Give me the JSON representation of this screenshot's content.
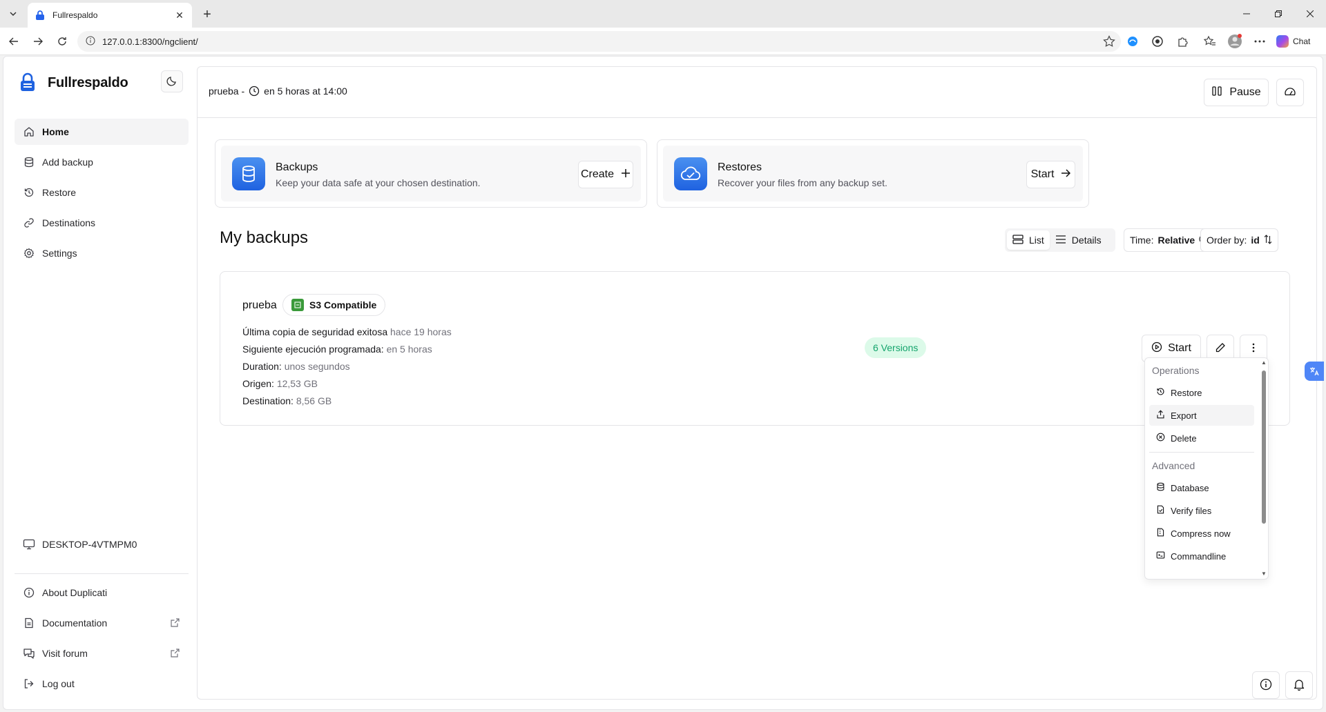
{
  "browser": {
    "tab_title": "Fullrespaldo",
    "url": "127.0.0.1:8300/ngclient/",
    "chat_label": "Chat"
  },
  "sidebar": {
    "brand": "Fullrespaldo",
    "items": [
      {
        "label": "Home",
        "icon": "home-icon",
        "active": true
      },
      {
        "label": "Add backup",
        "icon": "database-icon"
      },
      {
        "label": "Restore",
        "icon": "history-icon"
      },
      {
        "label": "Destinations",
        "icon": "link-icon"
      },
      {
        "label": "Settings",
        "icon": "gear-icon"
      }
    ],
    "machine": "DESKTOP-4VTMPM0",
    "bottom": [
      {
        "label": "About Duplicati",
        "icon": "info-icon"
      },
      {
        "label": "Documentation",
        "icon": "document-icon",
        "external": true
      },
      {
        "label": "Visit forum",
        "icon": "chat-icon",
        "external": true
      },
      {
        "label": "Log out",
        "icon": "logout-icon"
      }
    ]
  },
  "topbar": {
    "status_name": "prueba -",
    "status_next": "en 5 horas at 14:00",
    "pause_label": "Pause"
  },
  "cards": {
    "backups": {
      "title": "Backups",
      "subtitle": "Keep your data safe at your chosen destination.",
      "button": "Create"
    },
    "restores": {
      "title": "Restores",
      "subtitle": "Recover your files from any backup set.",
      "button": "Start"
    }
  },
  "my_backups": {
    "title": "My backups",
    "view_list": "List",
    "view_details": "Details",
    "time_label": "Time:",
    "time_value": "Relative",
    "order_label": "Order by:",
    "order_value": "id"
  },
  "backup": {
    "name": "prueba",
    "destination_type": "S3 Compatible",
    "rows": [
      {
        "label": "Última copia de seguridad exitosa",
        "value": "hace 19 horas"
      },
      {
        "label": "Siguiente ejecución programada:",
        "value": "en 5 horas"
      },
      {
        "label": "Duration:",
        "value": "unos segundos"
      },
      {
        "label": "Origen:",
        "value": "12,53 GB"
      },
      {
        "label": "Destination:",
        "value": "8,56 GB"
      }
    ],
    "versions": "6 Versions",
    "start_label": "Start"
  },
  "menu": {
    "group_operations": "Operations",
    "operations": [
      {
        "label": "Restore",
        "icon": "history-icon"
      },
      {
        "label": "Export",
        "icon": "share-icon"
      },
      {
        "label": "Delete",
        "icon": "circle-x-icon"
      }
    ],
    "group_advanced": "Advanced",
    "advanced": [
      {
        "label": "Database",
        "icon": "database-icon"
      },
      {
        "label": "Verify files",
        "icon": "file-check-icon"
      },
      {
        "label": "Compress now",
        "icon": "file-archive-icon"
      },
      {
        "label": "Commandline",
        "icon": "terminal-icon"
      }
    ]
  },
  "colors": {
    "accent": "#1f62e0",
    "versions_bg": "#dcfae9",
    "versions_text": "#14a46c"
  }
}
